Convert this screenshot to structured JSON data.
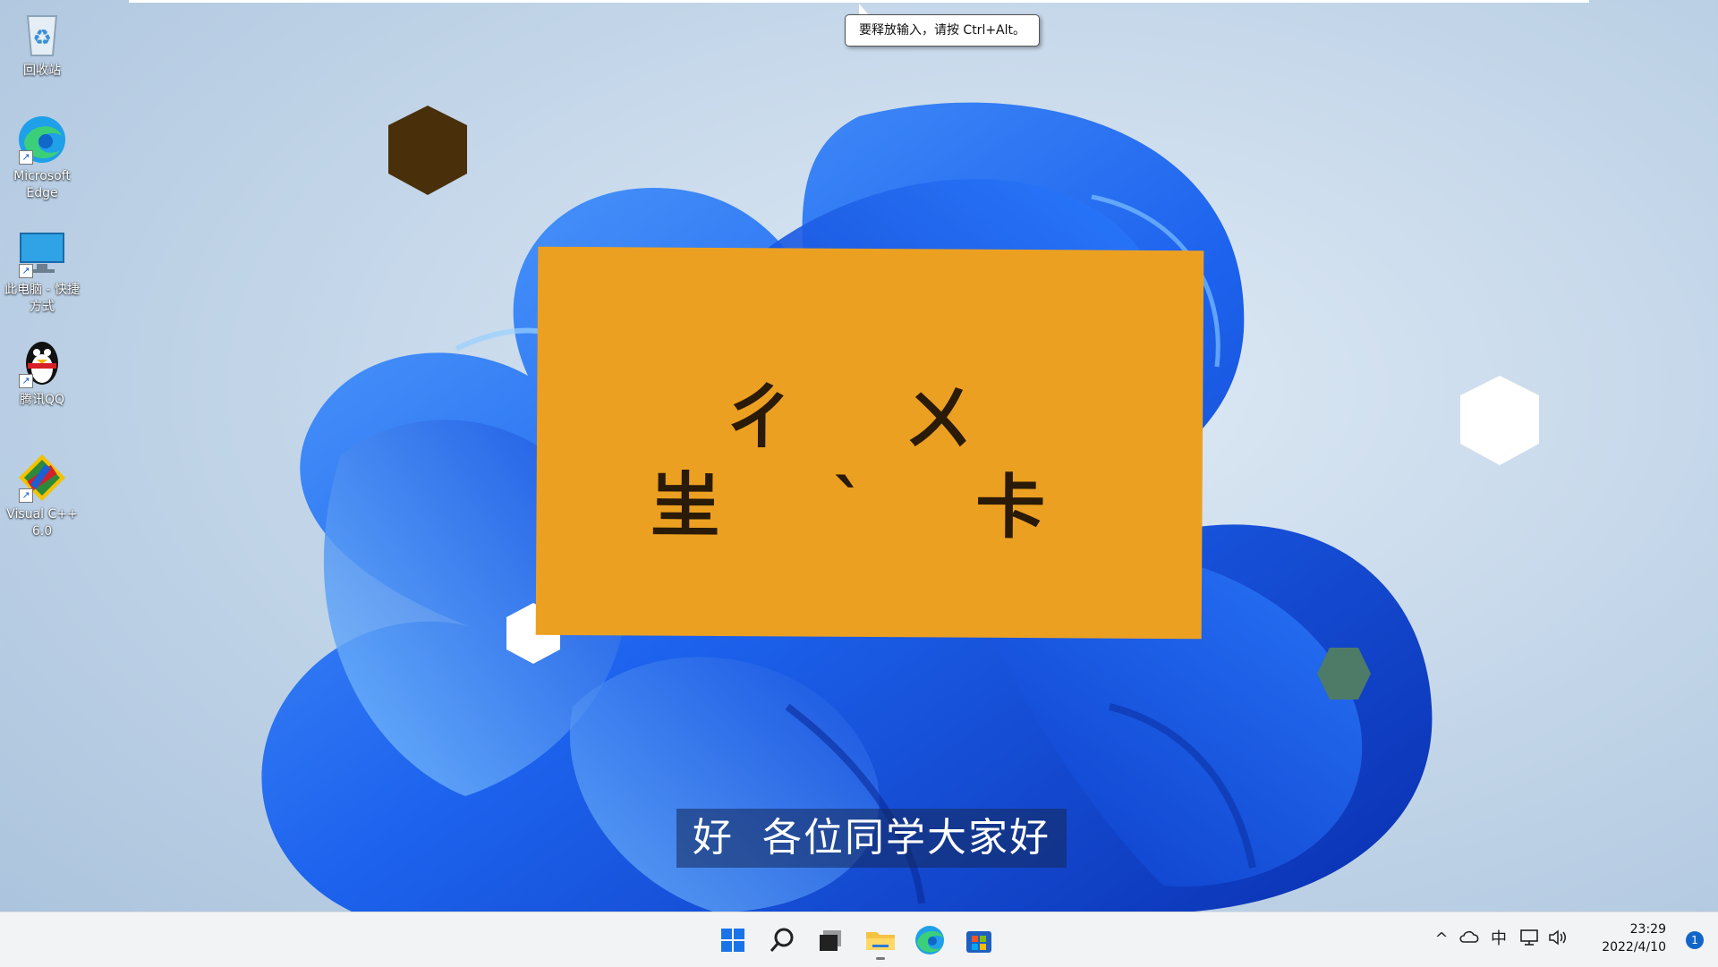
{
  "desktop": {
    "icons": [
      {
        "label": "回收站",
        "icon": "recycle-bin-icon"
      },
      {
        "label": "Microsoft\nEdge",
        "icon": "edge-icon"
      },
      {
        "label": "此电脑 - 快捷\n方式",
        "icon": "computer-icon"
      },
      {
        "label": "腾讯QQ",
        "icon": "qq-penguin-icon"
      },
      {
        "label": "Visual C++\n6.0",
        "icon": "visual-cpp-icon"
      }
    ],
    "tooltip": "要释放输入，请按 Ctrl+Alt。",
    "card": {
      "line1": "ㄔ ㄨ",
      "line2": "㞷 ˋ 卡",
      "color": "#eca021"
    },
    "subtitle": "好  各位同学大家好"
  },
  "taskbar": {
    "pinned": [
      "start-icon",
      "search-icon",
      "task-view-icon",
      "file-explorer-icon",
      "edge-icon",
      "store-icon"
    ],
    "tray": {
      "chevron": "^",
      "ime": "中",
      "time": "23:29",
      "date": "2022/4/10",
      "notification_count": "1"
    }
  },
  "colors": {
    "accent": "#1266c8",
    "bloom": "#1a5fe0",
    "taskbar": "#f2f3f5"
  }
}
